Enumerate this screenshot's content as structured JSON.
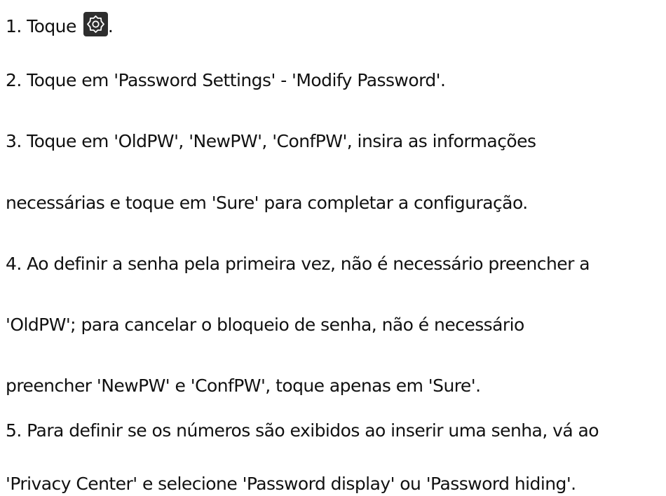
{
  "steps": [
    {
      "before_icon": "1. Toque",
      "icon": "settings-gear-icon",
      "after_icon": "."
    },
    {
      "text": "2. Toque em 'Password Settings' - 'Modify Password'."
    },
    {
      "text": "3. Toque em 'OldPW', 'NewPW', 'ConfPW', insira as informações"
    },
    {
      "text": "necessárias e toque em 'Sure' para completar a configuração."
    },
    {
      "text": "4. Ao definir a senha pela primeira vez, não é necessário preencher a"
    },
    {
      "text": "'OldPW'; para cancelar o bloqueio de senha, não é necessário"
    },
    {
      "text": "preencher 'NewPW' e 'ConfPW', toque apenas em 'Sure'."
    },
    {
      "text": "5. Para definir se os números são exibidos ao inserir uma senha, vá ao"
    },
    {
      "text": "'Privacy Center' e selecione 'Password display' ou 'Password hiding'."
    }
  ],
  "colors": {
    "text": "#111111",
    "icon_background": "#2e2e2e",
    "icon_stroke": "#ffffff"
  }
}
